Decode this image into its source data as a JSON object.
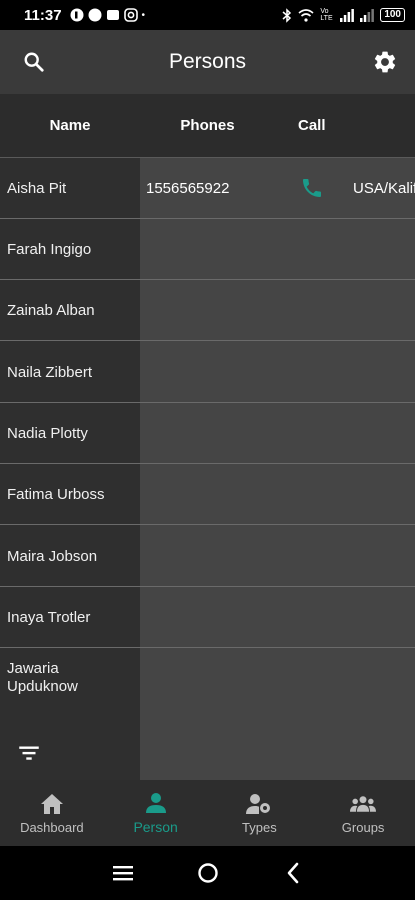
{
  "status_bar": {
    "time": "11:37",
    "battery": "100",
    "signal_label": "Vo LTE"
  },
  "app_bar": {
    "title": "Persons",
    "search_icon": "search-icon",
    "settings_icon": "gear-icon"
  },
  "table": {
    "headers": {
      "name": "Name",
      "phones": "Phones",
      "call": "Call"
    },
    "rows": [
      {
        "name": "Aisha Pit",
        "phone": "1556565922",
        "location": "USA/Kalif"
      },
      {
        "name": "Farah Ingigo",
        "phone": "",
        "location": ""
      },
      {
        "name": "Zainab Alban",
        "phone": "",
        "location": ""
      },
      {
        "name": "Naila Zibbert",
        "phone": "",
        "location": ""
      },
      {
        "name": "Nadia Plotty",
        "phone": "",
        "location": ""
      },
      {
        "name": "Fatima Urboss",
        "phone": "",
        "location": ""
      },
      {
        "name": "Maira Jobson",
        "phone": "",
        "location": ""
      },
      {
        "name": "Inaya Trotler",
        "phone": "",
        "location": ""
      },
      {
        "name": "Jawaria Upduknow",
        "phone": "",
        "location": ""
      }
    ]
  },
  "bottom_nav": {
    "items": [
      {
        "label": "Dashboard",
        "icon": "home-icon",
        "active": false
      },
      {
        "label": "Person",
        "icon": "person-icon",
        "active": true
      },
      {
        "label": "Types",
        "icon": "person-settings-icon",
        "active": false
      },
      {
        "label": "Groups",
        "icon": "groups-icon",
        "active": false
      }
    ]
  },
  "colors": {
    "accent": "#1a9b8a",
    "app_bar": "#3a3a3a",
    "name_column": "#2f2f2f",
    "body": "#454545"
  }
}
